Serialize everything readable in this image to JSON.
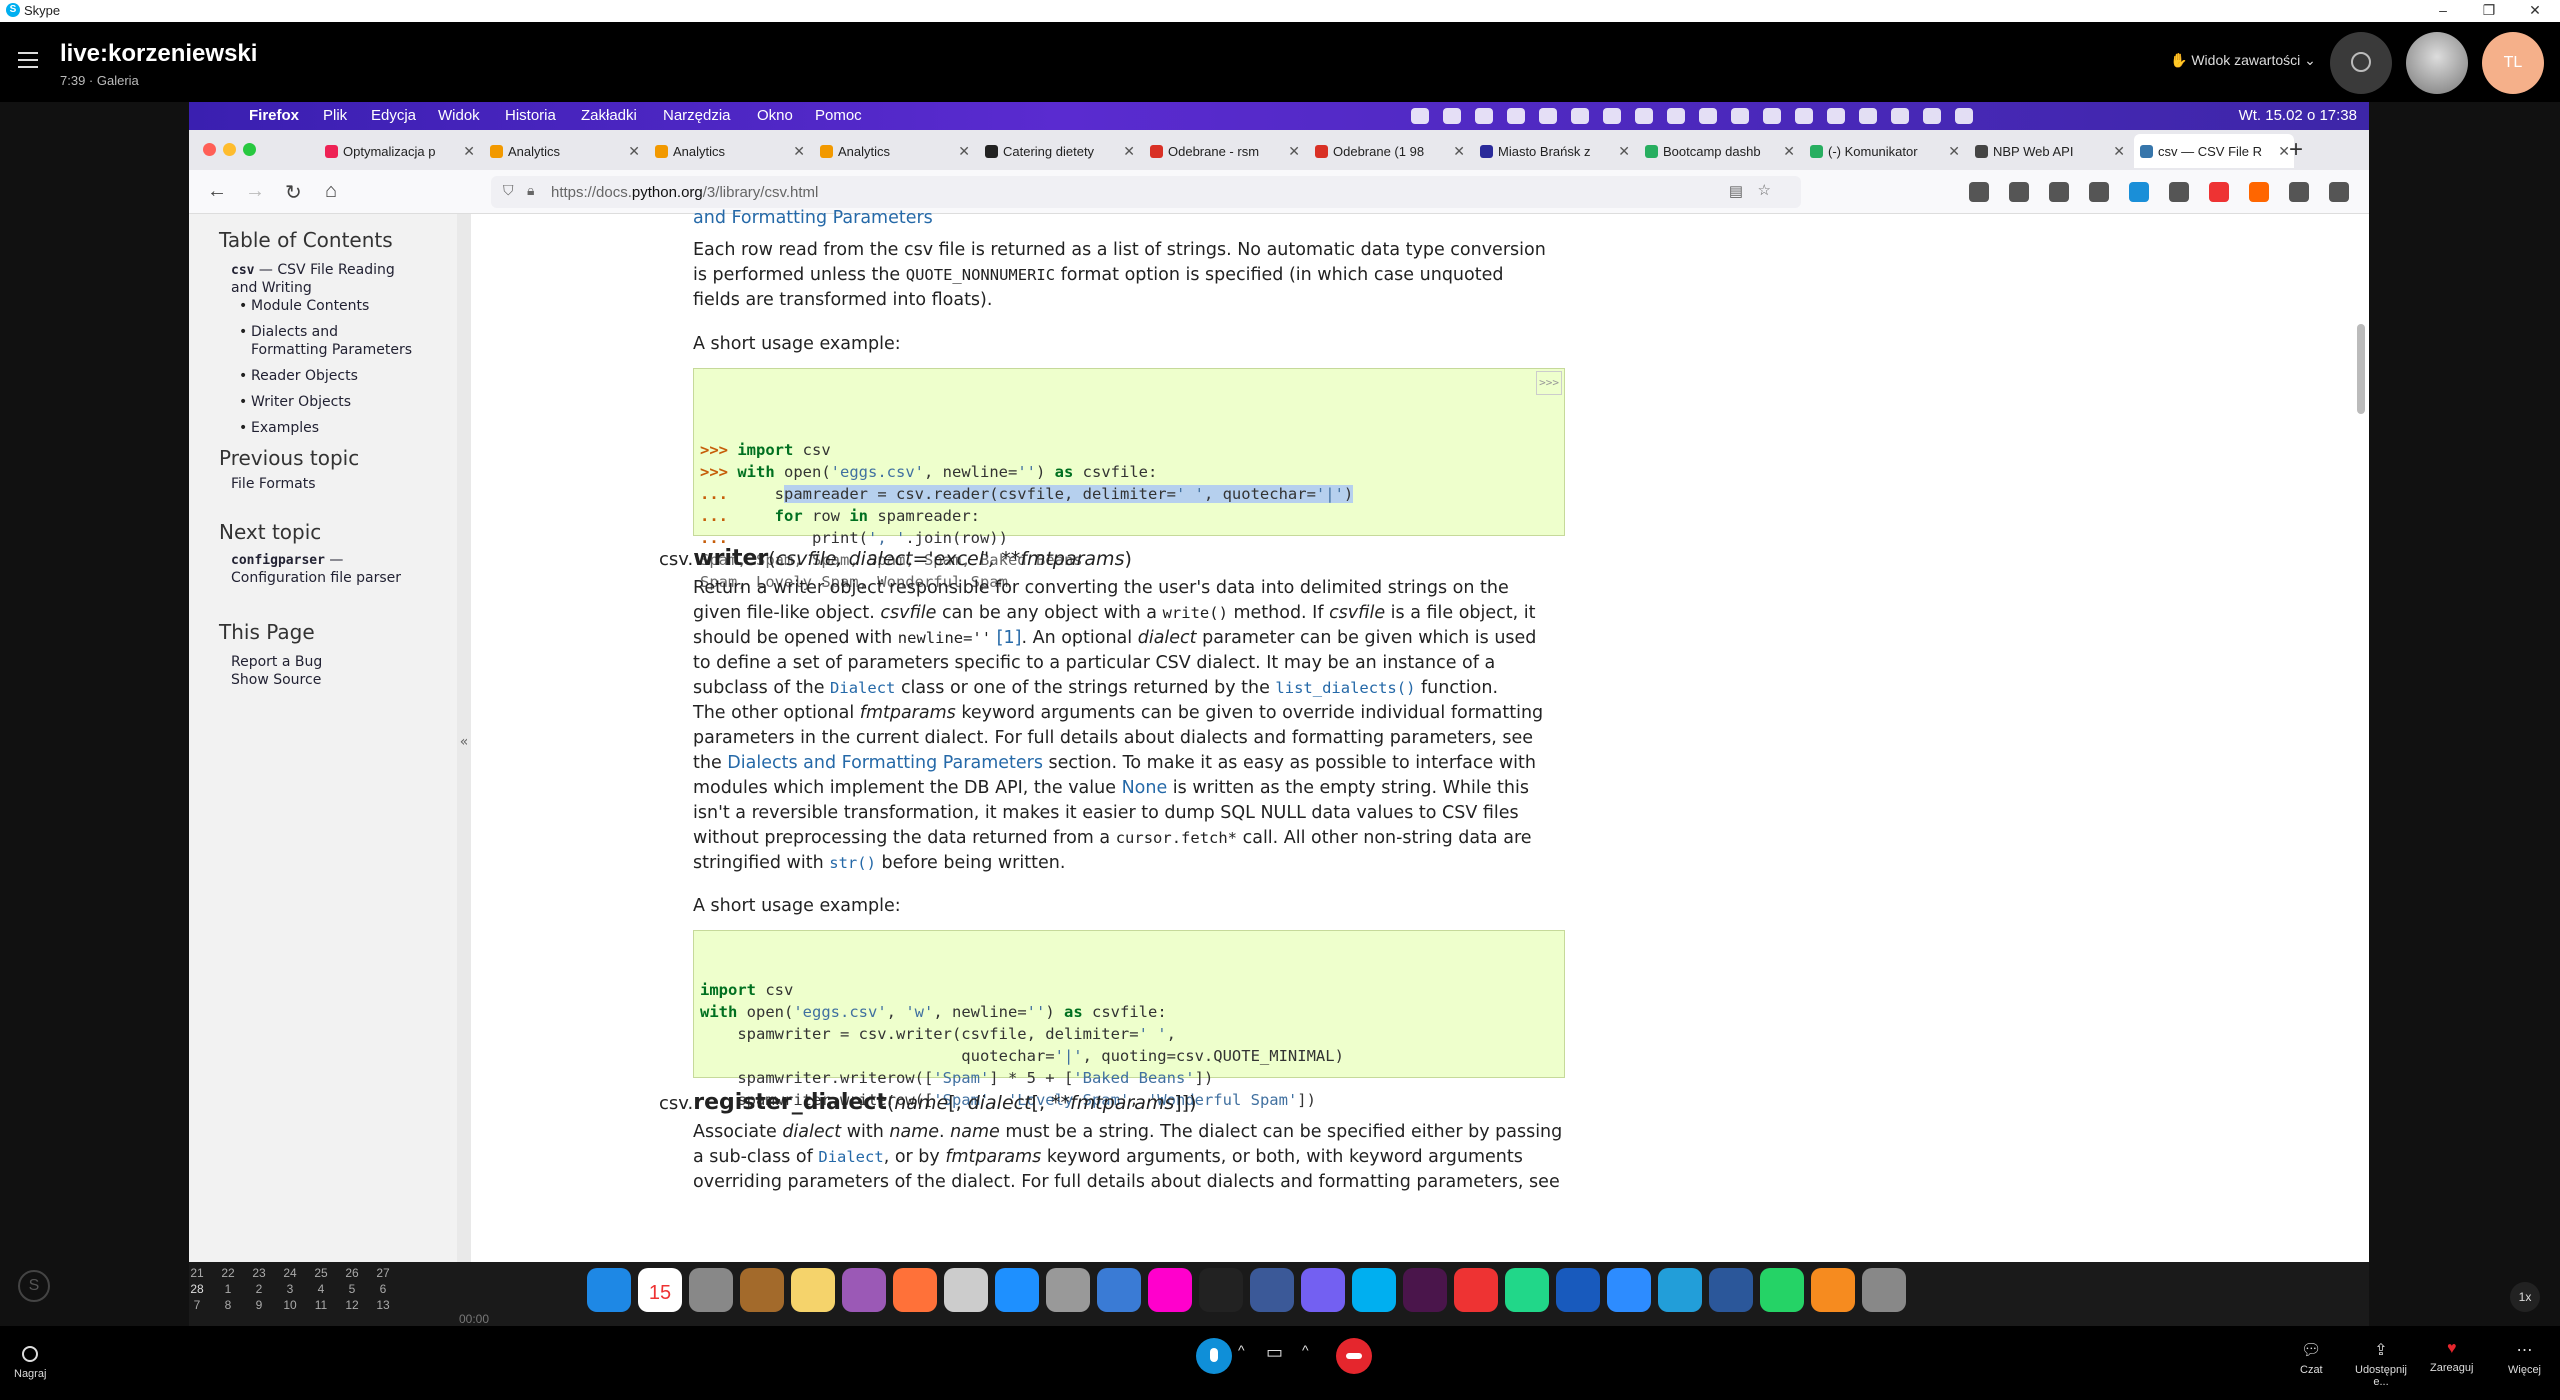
{
  "window": {
    "app_title": "Skype",
    "minimize": "–",
    "restore": "❐",
    "close": "✕"
  },
  "call": {
    "name": "live:korzeniewski",
    "time": "7:39",
    "gallery": "Galeria",
    "view_content": "Widok zawartości",
    "avatar_initials": "TL"
  },
  "menubar": {
    "items": [
      "Firefox",
      "Plik",
      "Edycja",
      "Widok",
      "Historia",
      "Zakładki",
      "Narzędzia",
      "Okno",
      "Pomoc"
    ],
    "clock": "Wt. 15.02 o 17:38"
  },
  "tabs": [
    {
      "label": "Optymalizacja p",
      "color": "#e25"
    },
    {
      "label": "Analytics",
      "color": "#f29900"
    },
    {
      "label": "Analytics",
      "color": "#f29900"
    },
    {
      "label": "Analytics",
      "color": "#f29900"
    },
    {
      "label": "Catering dietety",
      "color": "#222"
    },
    {
      "label": "Odebrane - rsm",
      "color": "#d93025"
    },
    {
      "label": "Odebrane (1 98",
      "color": "#d93025"
    },
    {
      "label": "Miasto Brańsk z",
      "color": "#2a2a9a"
    },
    {
      "label": "Bootcamp dashb",
      "color": "#27ae60"
    },
    {
      "label": "(-) Komunikator",
      "color": "#27ae60"
    },
    {
      "label": "NBP Web API",
      "color": "#444"
    },
    {
      "label": "csv — CSV File R",
      "color": "#3776ab"
    }
  ],
  "url": {
    "prefix": "https://docs.",
    "domain": "python.org",
    "path": "/3/library/csv.html"
  },
  "sidebar": {
    "toc_title": "Table of Contents",
    "toc_main_code": "csv",
    "toc_main_rest": " — CSV File Reading",
    "toc_main_rest2": "and Writing",
    "toc_items": [
      "Module Contents",
      "Dialects and",
      "Formatting Parameters",
      "Reader Objects",
      "Writer Objects",
      "Examples"
    ],
    "prev_title": "Previous topic",
    "prev_link": "File Formats",
    "next_title": "Next topic",
    "next_code": "configparser",
    "next_rest": " —",
    "next_rest2": "Configuration file parser",
    "page_title": "This Page",
    "page_links": [
      "Report a Bug",
      "Show Source"
    ],
    "collapse": "«"
  },
  "doc": {
    "top_link": "and Formatting Parameters",
    "p1a": "Each row read from the csv file is returned as a list of strings. No automatic data type conversion",
    "p1b_pre": "is performed unless the ",
    "p1b_code": "QUOTE_NONNUMERIC",
    "p1b_post": " format option is specified (in which case unquoted",
    "p1c": "fields are transformed into floats).",
    "usage1": "A short usage example:",
    "copy": ">>>",
    "writer_mod": "csv.",
    "writer_name": "writer",
    "writer_args": "csvfile, dialect='excel', **fmtparams",
    "w1": "Return a writer object responsible for converting the user's data into delimited strings on the",
    "w2a": "given file-like object. ",
    "w2b": "csvfile",
    "w2c": " can be any object with a ",
    "w2d": "write()",
    "w2e": " method. If ",
    "w2f": "csvfile",
    "w2g": " is a file object, it",
    "w3a": "should be opened with ",
    "w3b": "newline=''",
    "w3c": " [1]",
    "w3d": ". An optional ",
    "w3e": "dialect",
    "w3f": " parameter can be given which is used",
    "w4": "to define a set of parameters specific to a particular CSV dialect. It may be an instance of a",
    "w5a": "subclass of the ",
    "w5b": "Dialect",
    "w5c": " class or one of the strings returned by the ",
    "w5d": "list_dialects()",
    "w5e": " function.",
    "w6a": "The other optional ",
    "w6b": "fmtparams",
    "w6c": " keyword arguments can be given to override individual formatting",
    "w7": "parameters in the current dialect. For full details about dialects and formatting parameters, see",
    "w8a": "the ",
    "w8b": "Dialects and Formatting Parameters",
    "w8c": " section. To make it as easy as possible to interface with",
    "w9a": "modules which implement the DB API, the value ",
    "w9b": "None",
    "w9c": " is written as the empty string. While this",
    "w10": "isn't a reversible transformation, it makes it easier to dump SQL NULL data values to CSV files",
    "w11a": "without preprocessing the data returned from a ",
    "w11b": "cursor.fetch*",
    "w11c": " call. All other non-string data are",
    "w12a": "stringified with ",
    "w12b": "str()",
    "w12c": " before being written.",
    "usage2": "A short usage example:",
    "reg_mod": "csv.",
    "reg_name": "register_dialect",
    "reg_args_a": "name",
    "reg_args_b": "[, ",
    "reg_args_c": "dialect",
    "reg_args_d": "[, ",
    "reg_args_e": "**fmtparams",
    "reg_args_f": "]])",
    "r1a": "Associate ",
    "r1b": "dialect",
    "r1c": " with ",
    "r1d": "name",
    "r1e": ". ",
    "r1f": "name",
    "r1g": " must be a string. The dialect can be specified either by passing",
    "r2a": "a sub-class of ",
    "r2b": "Dialect",
    "r2c": ", or by ",
    "r2d": "fmtparams",
    "r2e": " keyword arguments, or both, with keyword arguments",
    "r3": "overriding parameters of the dialect. For full details about dialects and formatting parameters, see"
  },
  "code1": [
    ">>> import csv",
    ">>> with open('eggs.csv', newline='') as csvfile:",
    "...     spamreader = csv.reader(csvfile, delimiter=' ', quotechar='|')",
    "...     for row in spamreader:",
    "...         print(', '.join(row))",
    "Spam, Spam, Spam, Spam, Spam, Baked Beans",
    "Spam, Lovely Spam, Wonderful Spam"
  ],
  "code2": [
    "import csv",
    "with open('eggs.csv', 'w', newline='') as csvfile:",
    "    spamwriter = csv.writer(csvfile, delimiter=' ',",
    "                            quotechar='|', quoting=csv.QUOTE_MINIMAL)",
    "    spamwriter.writerow(['Spam'] * 5 + ['Baked Beans'])",
    "    spamwriter.writerow(['Spam', 'Lovely Spam', 'Wonderful Spam'])"
  ],
  "calendar": {
    "rows": [
      [
        "21",
        "22",
        "23",
        "24",
        "25",
        "26",
        "27"
      ],
      [
        "28",
        "1",
        "2",
        "3",
        "4",
        "5",
        "6"
      ],
      [
        "7",
        "8",
        "9",
        "10",
        "11",
        "12",
        "13"
      ]
    ]
  },
  "timer": "00:00",
  "dock_badge": "15",
  "bottom": {
    "record": "Nagraj",
    "chat": "Czat",
    "share": "Udostępnij e...",
    "react": "Zareaguj",
    "more": "Więcej",
    "zoom": "1x"
  }
}
